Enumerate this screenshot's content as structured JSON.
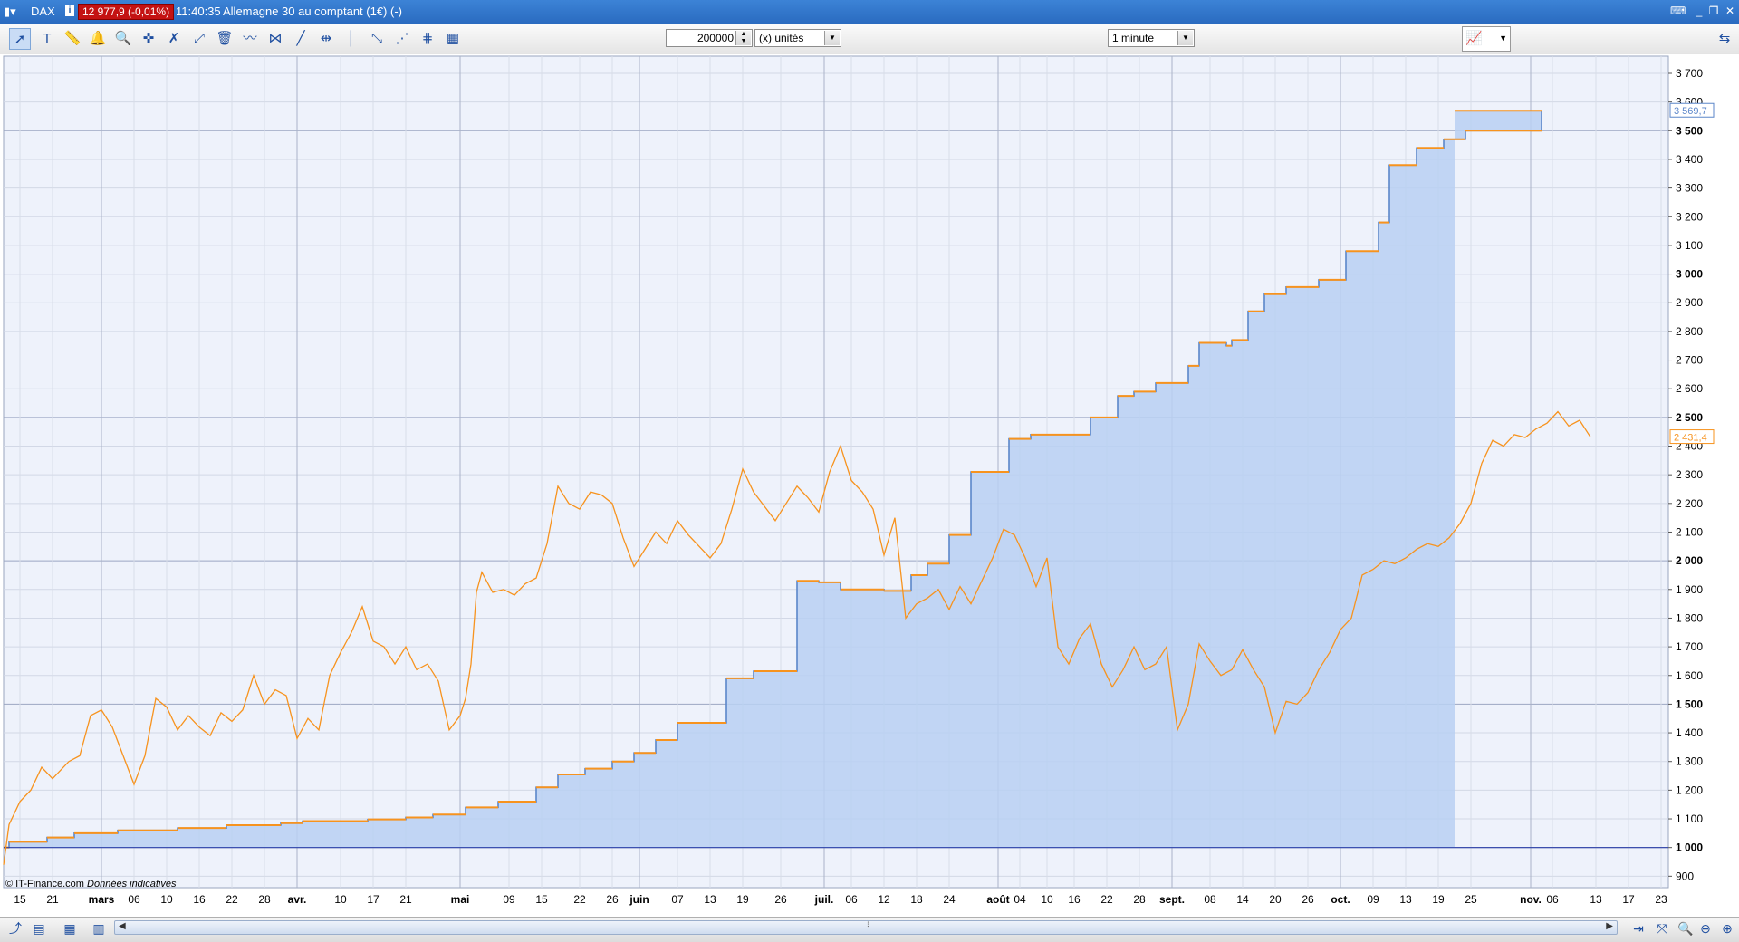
{
  "window": {
    "symbol": "DAX",
    "info_label": "i",
    "price_badge": "12 977,9 (-0,01%)",
    "time": "11:40:35",
    "instrument": "Allemagne 30 au comptant (1€) (-)"
  },
  "toolbar": {
    "quantity_value": "200000",
    "quantity_unit": "(x) unités",
    "timeframe": "1 minute"
  },
  "footer": {
    "source": "© IT-Finance.com",
    "note": "Données indicatives"
  },
  "colors": {
    "equity_line": "#5b86c9",
    "equity_fill": "#b8d0f2",
    "equity_cap": "#f7931e",
    "price_line": "#f7931e",
    "baseline": "#2b3fa8"
  },
  "chart_data": {
    "type": "line",
    "ylim": [
      860,
      3760
    ],
    "yticks": [
      900,
      1000,
      1100,
      1200,
      1300,
      1400,
      1500,
      1600,
      1700,
      1800,
      1900,
      2000,
      2100,
      2200,
      2300,
      2400,
      2500,
      2600,
      2700,
      2800,
      2900,
      3000,
      3100,
      3200,
      3300,
      3400,
      3500,
      3600,
      3700
    ],
    "ytick_labels": [
      "900",
      "1 000",
      "1 100",
      "1 200",
      "1 300",
      "1 400",
      "1 500",
      "1 600",
      "1 700",
      "1 800",
      "1 900",
      "2 000",
      "2 100",
      "2 200",
      "2 300",
      "2 400",
      "2 500",
      "2 600",
      "2 700",
      "2 800",
      "2 900",
      "3 000",
      "3 100",
      "3 200",
      "3 300",
      "3 400",
      "3 500",
      "3 600",
      "3 700"
    ],
    "ytick_bold": [
      "1 000",
      "1 500",
      "2 000",
      "2 500",
      "3 000",
      "3 500"
    ],
    "xlim": [
      "2020-02-10",
      "2020-10-24"
    ],
    "xticks": [
      {
        "date": "2020-02-13",
        "label": "15"
      },
      {
        "date": "2020-02-19",
        "label": "21"
      },
      {
        "date": "2020-02-28",
        "label": "mars",
        "bold": true
      },
      {
        "date": "2020-03-05",
        "label": "06"
      },
      {
        "date": "2020-03-11",
        "label": "10"
      },
      {
        "date": "2020-03-17",
        "label": "16"
      },
      {
        "date": "2020-03-23",
        "label": "22"
      },
      {
        "date": "2020-03-29",
        "label": "28"
      },
      {
        "date": "2020-04-04",
        "label": "avr.",
        "bold": true
      },
      {
        "date": "2020-04-12",
        "label": "10"
      },
      {
        "date": "2020-04-18",
        "label": "17"
      },
      {
        "date": "2020-04-24",
        "label": "21"
      },
      {
        "date": "2020-05-04",
        "label": "mai",
        "bold": true
      },
      {
        "date": "2020-05-13",
        "label": "09"
      },
      {
        "date": "2020-05-19",
        "label": "15"
      },
      {
        "date": "2020-05-26",
        "label": "22"
      },
      {
        "date": "2020-06-01",
        "label": "26"
      },
      {
        "date": "2020-06-06",
        "label": "juin",
        "bold": true
      },
      {
        "date": "2020-06-13",
        "label": "07"
      },
      {
        "date": "2020-06-19",
        "label": "13"
      },
      {
        "date": "2020-06-25",
        "label": "19"
      },
      {
        "date": "2020-07-02",
        "label": "26"
      },
      {
        "date": "2020-07-10",
        "label": "juil.",
        "bold": true
      },
      {
        "date": "2020-07-15",
        "label": "06"
      },
      {
        "date": "2020-07-21",
        "label": "12"
      },
      {
        "date": "2020-07-27",
        "label": "18"
      },
      {
        "date": "2020-08-02",
        "label": "24"
      },
      {
        "date": "2020-08-11",
        "label": "août",
        "bold": true
      },
      {
        "date": "2020-08-15",
        "label": "04"
      },
      {
        "date": "2020-08-20",
        "label": "10"
      },
      {
        "date": "2020-08-25",
        "label": "16"
      },
      {
        "date": "2020-08-31",
        "label": "22"
      },
      {
        "date": "2020-09-06",
        "label": "28"
      },
      {
        "date": "2020-09-12",
        "label": "sept.",
        "bold": true
      },
      {
        "date": "2020-09-19",
        "label": "08"
      },
      {
        "date": "2020-09-25",
        "label": "14"
      },
      {
        "date": "2020-10-01",
        "label": "20"
      },
      {
        "date": "2020-10-07",
        "label": "26"
      },
      {
        "date": "2020-10-13",
        "label": "oct.",
        "bold": true
      },
      {
        "date": "2020-10-19",
        "label": "09"
      },
      {
        "date": "2020-10-25",
        "label": "13"
      },
      {
        "date": "2020-10-31",
        "label": "19"
      },
      {
        "date": "2020-11-06",
        "label": "25"
      },
      {
        "date": "2020-11-17",
        "label": "nov.",
        "bold": true
      },
      {
        "date": "2020-11-21",
        "label": "06"
      },
      {
        "date": "2020-11-29",
        "label": "13"
      },
      {
        "date": "2020-12-05",
        "label": "17"
      },
      {
        "date": "2020-12-11",
        "label": "23"
      }
    ],
    "last_value_labels": [
      {
        "series": "equity",
        "value": 3569.7,
        "label": "3 569,7"
      },
      {
        "series": "price",
        "value": 2431.4,
        "label": "2 431,4"
      }
    ],
    "series": [
      {
        "id": "equity",
        "style": "step-area",
        "end_date": "2020-11-03",
        "points": [
          [
            "2020-02-10",
            1000
          ],
          [
            "2020-02-11",
            1020
          ],
          [
            "2020-02-18",
            1035
          ],
          [
            "2020-02-23",
            1050
          ],
          [
            "2020-03-02",
            1060
          ],
          [
            "2020-03-13",
            1068
          ],
          [
            "2020-03-22",
            1078
          ],
          [
            "2020-04-01",
            1085
          ],
          [
            "2020-04-05",
            1092
          ],
          [
            "2020-04-17",
            1098
          ],
          [
            "2020-04-24",
            1105
          ],
          [
            "2020-04-29",
            1115
          ],
          [
            "2020-05-05",
            1140
          ],
          [
            "2020-05-11",
            1160
          ],
          [
            "2020-05-18",
            1210
          ],
          [
            "2020-05-22",
            1255
          ],
          [
            "2020-05-27",
            1275
          ],
          [
            "2020-06-01",
            1300
          ],
          [
            "2020-06-05",
            1330
          ],
          [
            "2020-06-09",
            1375
          ],
          [
            "2020-06-13",
            1435
          ],
          [
            "2020-06-22",
            1590
          ],
          [
            "2020-06-27",
            1615
          ],
          [
            "2020-07-05",
            1930
          ],
          [
            "2020-07-09",
            1925
          ],
          [
            "2020-07-13",
            1900
          ],
          [
            "2020-07-21",
            1895
          ],
          [
            "2020-07-26",
            1950
          ],
          [
            "2020-07-29",
            1990
          ],
          [
            "2020-08-02",
            2090
          ],
          [
            "2020-08-06",
            2310
          ],
          [
            "2020-08-13",
            2425
          ],
          [
            "2020-08-17",
            2440
          ],
          [
            "2020-08-28",
            2500
          ],
          [
            "2020-09-02",
            2575
          ],
          [
            "2020-09-05",
            2590
          ],
          [
            "2020-09-09",
            2620
          ],
          [
            "2020-09-15",
            2680
          ],
          [
            "2020-09-17",
            2760
          ],
          [
            "2020-09-22",
            2750
          ],
          [
            "2020-09-23",
            2770
          ],
          [
            "2020-09-26",
            2870
          ],
          [
            "2020-09-29",
            2930
          ],
          [
            "2020-10-03",
            2955
          ],
          [
            "2020-10-09",
            2980
          ],
          [
            "2020-10-14",
            3080
          ],
          [
            "2020-10-20",
            3180
          ],
          [
            "2020-10-22",
            3380
          ],
          [
            "2020-10-27",
            3440
          ],
          [
            "2020-11-01",
            3470
          ],
          [
            "2020-11-05",
            3500
          ],
          [
            "2020-11-17",
            3500
          ],
          [
            "2020-11-19",
            3569.7
          ]
        ]
      },
      {
        "id": "price",
        "style": "line",
        "points": [
          [
            "2020-02-10",
            940
          ],
          [
            "2020-02-11",
            1080
          ],
          [
            "2020-02-13",
            1160
          ],
          [
            "2020-02-15",
            1200
          ],
          [
            "2020-02-17",
            1280
          ],
          [
            "2020-02-19",
            1240
          ],
          [
            "2020-02-22",
            1300
          ],
          [
            "2020-02-24",
            1320
          ],
          [
            "2020-02-26",
            1460
          ],
          [
            "2020-02-28",
            1480
          ],
          [
            "2020-03-01",
            1420
          ],
          [
            "2020-03-03",
            1320
          ],
          [
            "2020-03-05",
            1220
          ],
          [
            "2020-03-07",
            1320
          ],
          [
            "2020-03-09",
            1520
          ],
          [
            "2020-03-11",
            1490
          ],
          [
            "2020-03-13",
            1410
          ],
          [
            "2020-03-15",
            1460
          ],
          [
            "2020-03-17",
            1420
          ],
          [
            "2020-03-19",
            1390
          ],
          [
            "2020-03-21",
            1470
          ],
          [
            "2020-03-23",
            1440
          ],
          [
            "2020-03-25",
            1480
          ],
          [
            "2020-03-27",
            1600
          ],
          [
            "2020-03-29",
            1500
          ],
          [
            "2020-03-31",
            1550
          ],
          [
            "2020-04-02",
            1530
          ],
          [
            "2020-04-04",
            1380
          ],
          [
            "2020-04-06",
            1450
          ],
          [
            "2020-04-08",
            1410
          ],
          [
            "2020-04-10",
            1600
          ],
          [
            "2020-04-12",
            1680
          ],
          [
            "2020-04-14",
            1750
          ],
          [
            "2020-04-16",
            1840
          ],
          [
            "2020-04-18",
            1720
          ],
          [
            "2020-04-20",
            1700
          ],
          [
            "2020-04-22",
            1640
          ],
          [
            "2020-04-24",
            1700
          ],
          [
            "2020-04-26",
            1620
          ],
          [
            "2020-04-28",
            1640
          ],
          [
            "2020-04-30",
            1580
          ],
          [
            "2020-05-02",
            1410
          ],
          [
            "2020-05-04",
            1460
          ],
          [
            "2020-05-05",
            1520
          ],
          [
            "2020-05-06",
            1640
          ],
          [
            "2020-05-07",
            1890
          ],
          [
            "2020-05-08",
            1960
          ],
          [
            "2020-05-10",
            1890
          ],
          [
            "2020-05-12",
            1900
          ],
          [
            "2020-05-14",
            1880
          ],
          [
            "2020-05-16",
            1920
          ],
          [
            "2020-05-18",
            1940
          ],
          [
            "2020-05-20",
            2060
          ],
          [
            "2020-05-22",
            2260
          ],
          [
            "2020-05-24",
            2200
          ],
          [
            "2020-05-26",
            2180
          ],
          [
            "2020-05-28",
            2240
          ],
          [
            "2020-05-30",
            2230
          ],
          [
            "2020-06-01",
            2200
          ],
          [
            "2020-06-03",
            2080
          ],
          [
            "2020-06-05",
            1980
          ],
          [
            "2020-06-07",
            2040
          ],
          [
            "2020-06-09",
            2100
          ],
          [
            "2020-06-11",
            2060
          ],
          [
            "2020-06-13",
            2140
          ],
          [
            "2020-06-15",
            2090
          ],
          [
            "2020-06-17",
            2050
          ],
          [
            "2020-06-19",
            2010
          ],
          [
            "2020-06-21",
            2060
          ],
          [
            "2020-06-23",
            2180
          ],
          [
            "2020-06-25",
            2320
          ],
          [
            "2020-06-27",
            2240
          ],
          [
            "2020-06-29",
            2190
          ],
          [
            "2020-07-01",
            2140
          ],
          [
            "2020-07-03",
            2200
          ],
          [
            "2020-07-05",
            2260
          ],
          [
            "2020-07-07",
            2220
          ],
          [
            "2020-07-09",
            2170
          ],
          [
            "2020-07-11",
            2310
          ],
          [
            "2020-07-13",
            2400
          ],
          [
            "2020-07-15",
            2280
          ],
          [
            "2020-07-17",
            2240
          ],
          [
            "2020-07-19",
            2180
          ],
          [
            "2020-07-21",
            2020
          ],
          [
            "2020-07-23",
            2150
          ],
          [
            "2020-07-25",
            1800
          ],
          [
            "2020-07-27",
            1850
          ],
          [
            "2020-07-29",
            1870
          ],
          [
            "2020-07-31",
            1900
          ],
          [
            "2020-08-02",
            1830
          ],
          [
            "2020-08-04",
            1910
          ],
          [
            "2020-08-06",
            1850
          ],
          [
            "2020-08-08",
            1930
          ],
          [
            "2020-08-10",
            2010
          ],
          [
            "2020-08-12",
            2110
          ],
          [
            "2020-08-14",
            2090
          ],
          [
            "2020-08-16",
            2010
          ],
          [
            "2020-08-18",
            1910
          ],
          [
            "2020-08-20",
            2010
          ],
          [
            "2020-08-22",
            1700
          ],
          [
            "2020-08-24",
            1640
          ],
          [
            "2020-08-26",
            1730
          ],
          [
            "2020-08-28",
            1780
          ],
          [
            "2020-08-30",
            1640
          ],
          [
            "2020-09-01",
            1560
          ],
          [
            "2020-09-03",
            1620
          ],
          [
            "2020-09-05",
            1700
          ],
          [
            "2020-09-07",
            1620
          ],
          [
            "2020-09-09",
            1640
          ],
          [
            "2020-09-11",
            1700
          ],
          [
            "2020-09-13",
            1410
          ],
          [
            "2020-09-15",
            1500
          ],
          [
            "2020-09-17",
            1710
          ],
          [
            "2020-09-19",
            1650
          ],
          [
            "2020-09-21",
            1600
          ],
          [
            "2020-09-23",
            1620
          ],
          [
            "2020-09-25",
            1690
          ],
          [
            "2020-09-27",
            1620
          ],
          [
            "2020-09-29",
            1560
          ],
          [
            "2020-10-01",
            1400
          ],
          [
            "2020-10-03",
            1510
          ],
          [
            "2020-10-05",
            1500
          ],
          [
            "2020-10-07",
            1540
          ],
          [
            "2020-10-09",
            1620
          ],
          [
            "2020-10-11",
            1680
          ],
          [
            "2020-10-13",
            1760
          ],
          [
            "2020-10-15",
            1800
          ],
          [
            "2020-10-17",
            1950
          ],
          [
            "2020-10-19",
            1970
          ],
          [
            "2020-10-21",
            2000
          ],
          [
            "2020-10-23",
            1990
          ],
          [
            "2020-10-25",
            2010
          ],
          [
            "2020-10-27",
            2040
          ],
          [
            "2020-10-29",
            2060
          ],
          [
            "2020-10-31",
            2050
          ],
          [
            "2020-11-02",
            2080
          ],
          [
            "2020-11-04",
            2130
          ],
          [
            "2020-11-06",
            2200
          ],
          [
            "2020-11-08",
            2340
          ],
          [
            "2020-11-10",
            2420
          ],
          [
            "2020-11-12",
            2400
          ],
          [
            "2020-11-14",
            2440
          ],
          [
            "2020-11-16",
            2430
          ],
          [
            "2020-11-18",
            2460
          ],
          [
            "2020-11-20",
            2480
          ],
          [
            "2020-11-22",
            2520
          ],
          [
            "2020-11-24",
            2470
          ],
          [
            "2020-11-26",
            2490
          ],
          [
            "2020-11-28",
            2431.4
          ]
        ]
      }
    ]
  }
}
